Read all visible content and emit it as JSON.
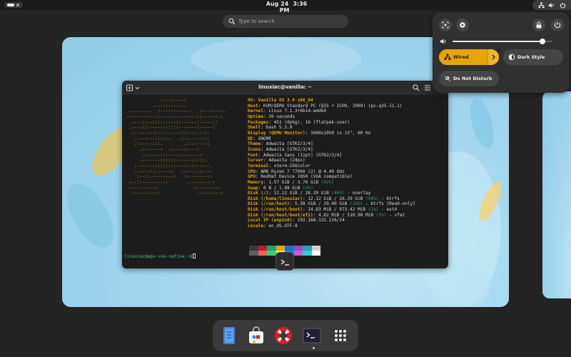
{
  "topbar": {
    "date": "Aug 24",
    "time": "3:36 PM",
    "icons": [
      "network-wired-icon",
      "volume-icon",
      "power-icon"
    ]
  },
  "search": {
    "placeholder": "Type to search",
    "icon": "search-icon"
  },
  "terminal": {
    "title": "linuxiac@vanilla: ~",
    "logo_lines": [
      "              :---:----:",
      "           .---::------.",
      "  .........  :----:------:  .:---:----.",
      " .-----------:-----:--------::-----:-:",
      "  .----:---:::-----:::------:------:",
      "  .----:::------:::::-------:-----:",
      "   :-----::::--------:::-------:-",
      "    .--------:::--.  .:---------.",
      "    .::----:::.        .:::-----:",
      "      .:------:  .:----:----:",
      "       .:-------:----:-------:",
      "      .-------::::::--:----::::.",
      "    .-------:::::------::::------.",
      "    .-----::------:   :-----::----",
      "     :--::---------:   :--------:-",
      "  :--::---------:       .---------:",
      "  :---------:              :--------:",
      "   :---------:              :--------:"
    ],
    "info": [
      {
        "label": "",
        "value": "OS: Vanilla OS 3.0 x86_64"
      },
      {
        "label": "Host",
        "value": "KVM/QEMU Standard PC (Q35 + ICH9, 2009) (pc-q35-11.1)"
      },
      {
        "label": "Kernel",
        "value": "Linux 7.1.3+6b14-amd64"
      },
      {
        "label": "Uptime",
        "value": "39 seconds"
      },
      {
        "label": "Packages",
        "value": "451 (dpkg), 16 (flatpak-user)"
      },
      {
        "label": "Shell",
        "value": "bash 5.3.9"
      },
      {
        "label": "Display (QEMU Monitor)",
        "value": "1680x1050 in 15\", 60 Hz"
      },
      {
        "label": "DE",
        "value": "GNOME"
      },
      {
        "label": "Theme",
        "value": "Adwaita [GTK2/3/4]"
      },
      {
        "label": "Icons",
        "value": "Adwaita [GTK2/3/4]"
      },
      {
        "label": "Font",
        "value": "Adwaita Sans (11pt) [GTK2/3/4]"
      },
      {
        "label": "Cursor",
        "value": "Adwaita (24px)"
      },
      {
        "label": "Terminal",
        "value": "xterm-256color"
      },
      {
        "label": "CPU",
        "value": "AMD Ryzen 7 7700X (2) @ 4.49 GHz"
      },
      {
        "label": "GPU",
        "value": "RedHat Device 1050 (VGA compatible)"
      },
      {
        "label": "Memory",
        "value": "1.57 GiB / 3.76 GiB",
        "pct": "(42%)"
      },
      {
        "label": "Swap",
        "value": "0 B / 1.88 GiB",
        "pct": "(0%)"
      },
      {
        "label": "Disk (/)",
        "value": "12.12 GiB / 28.39 GiB",
        "pct": "(46%)",
        "suffix": " - overlay"
      },
      {
        "label": "Disk (/home/linuxiac)",
        "value": "12.12 GiB / 26.39 GiB",
        "pct": "(46%)",
        "suffix": " - btrfs"
      },
      {
        "label": "Disk (/run/host)",
        "value": "5.38 GiB / 29.00 GiB",
        "pct": "(28%)",
        "suffix": " - btrfs [Read-only]"
      },
      {
        "label": "Disk (/run/host/boot)",
        "value": "14.83 MiB / 973.42 MiB",
        "pct": "(1%)",
        "suffix": " - ext4"
      },
      {
        "label": "Disk (/run/host/boot/efi)",
        "value": "4.82 MiB / 510.98 MiB",
        "pct": "(1%)",
        "suffix": " - vfat"
      },
      {
        "label": "Local IP (enp1s0)",
        "value": "192.168.122.126/24"
      },
      {
        "label": "Locale",
        "value": "en_US.UTF-8"
      }
    ],
    "swatches_top": [
      "#3a3a3a",
      "#c01c28",
      "#26a269",
      "#e5a50a",
      "#1c71d8",
      "#a347ba",
      "#2aa1b3",
      "#d0cfcc"
    ],
    "swatches_bottom": [
      "#5e5c64",
      "#f66151",
      "#33d17a",
      "#f8e45c",
      "#2a7bde",
      "#c061cb",
      "#33c7de",
      "#ffffff"
    ],
    "prompt": "linuxiac@apx-vso-native:~$"
  },
  "quick_settings": {
    "volume_level": 0.9,
    "tiles": {
      "wired": "Wired",
      "dark_style": "Dark Style",
      "dnd": "Do Not Disturb"
    },
    "accent": "#e5a50a"
  },
  "dock": {
    "apps": [
      "files-icon",
      "software-icon",
      "help-icon",
      "terminal-icon",
      "app-grid-icon"
    ]
  }
}
